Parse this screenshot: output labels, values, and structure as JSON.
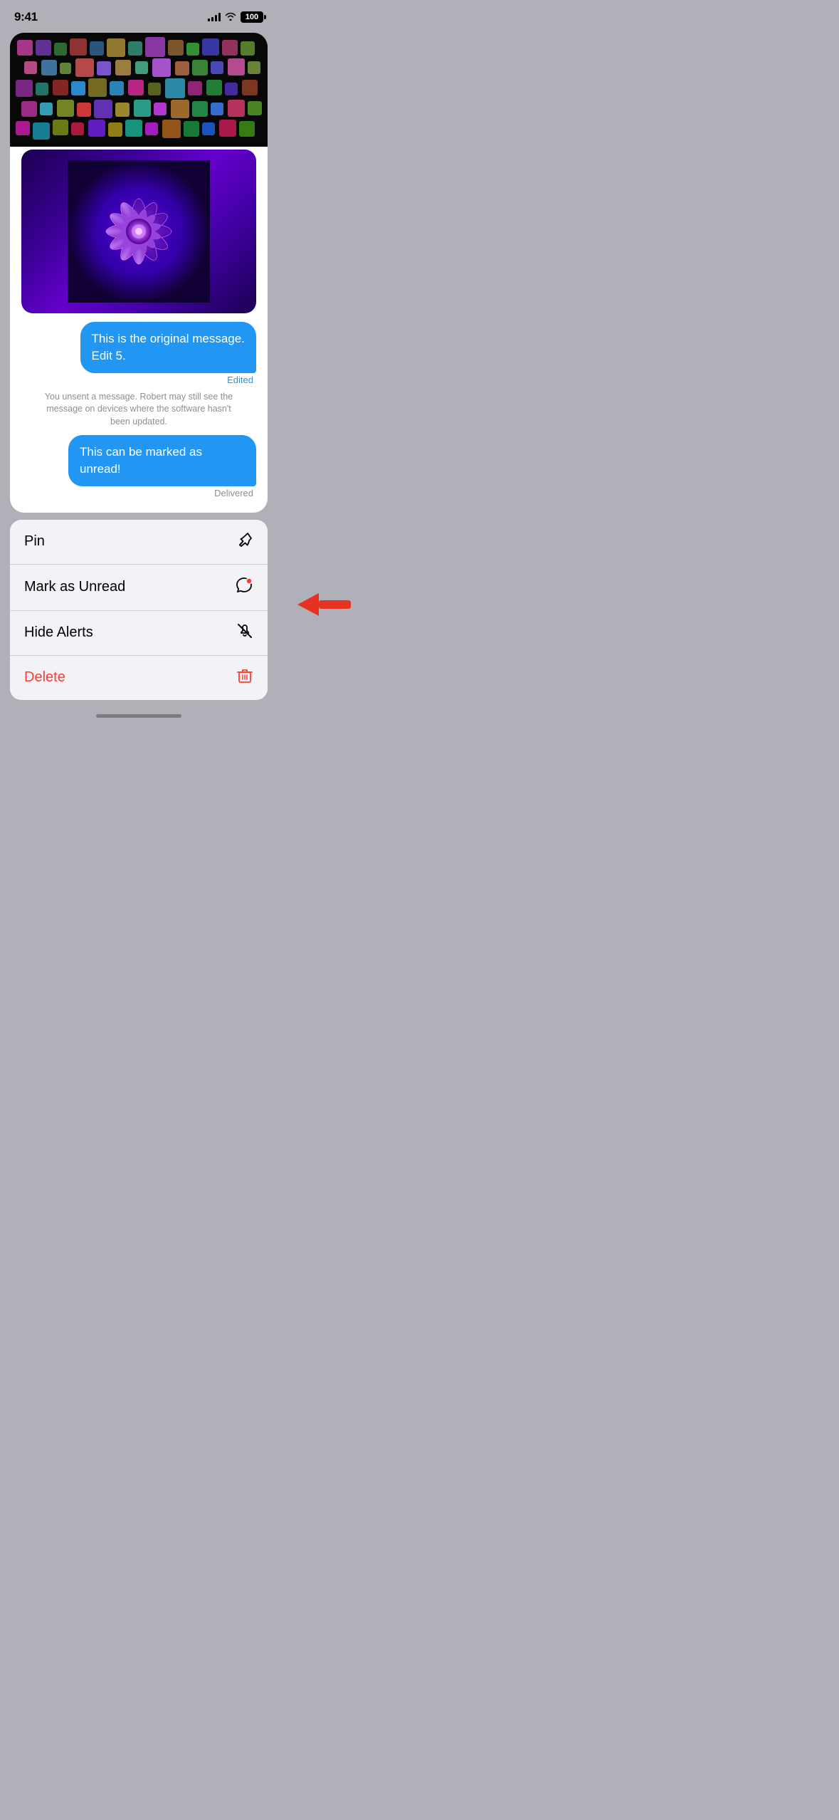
{
  "statusBar": {
    "time": "9:41",
    "battery": "100",
    "signalBars": [
      4,
      6,
      8,
      10,
      12
    ],
    "showWifi": true
  },
  "messages": {
    "editedMessage": "This is the original message. Edit 5.",
    "editedLabel": "Edited",
    "unsentNotice": "You unsent a message. Robert may still see the message on devices where the software hasn't been updated.",
    "markedMessage": "This can be marked as unread!",
    "deliveredLabel": "Delivered"
  },
  "contextMenu": {
    "items": [
      {
        "label": "Pin",
        "icon": "📌",
        "id": "pin",
        "isDelete": false
      },
      {
        "label": "Mark as Unread",
        "icon": "💬•",
        "id": "mark-unread",
        "isDelete": false
      },
      {
        "label": "Hide Alerts",
        "icon": "🔕",
        "id": "hide-alerts",
        "isDelete": false
      },
      {
        "label": "Delete",
        "icon": "🗑",
        "id": "delete",
        "isDelete": true
      }
    ]
  },
  "homeIndicator": true
}
